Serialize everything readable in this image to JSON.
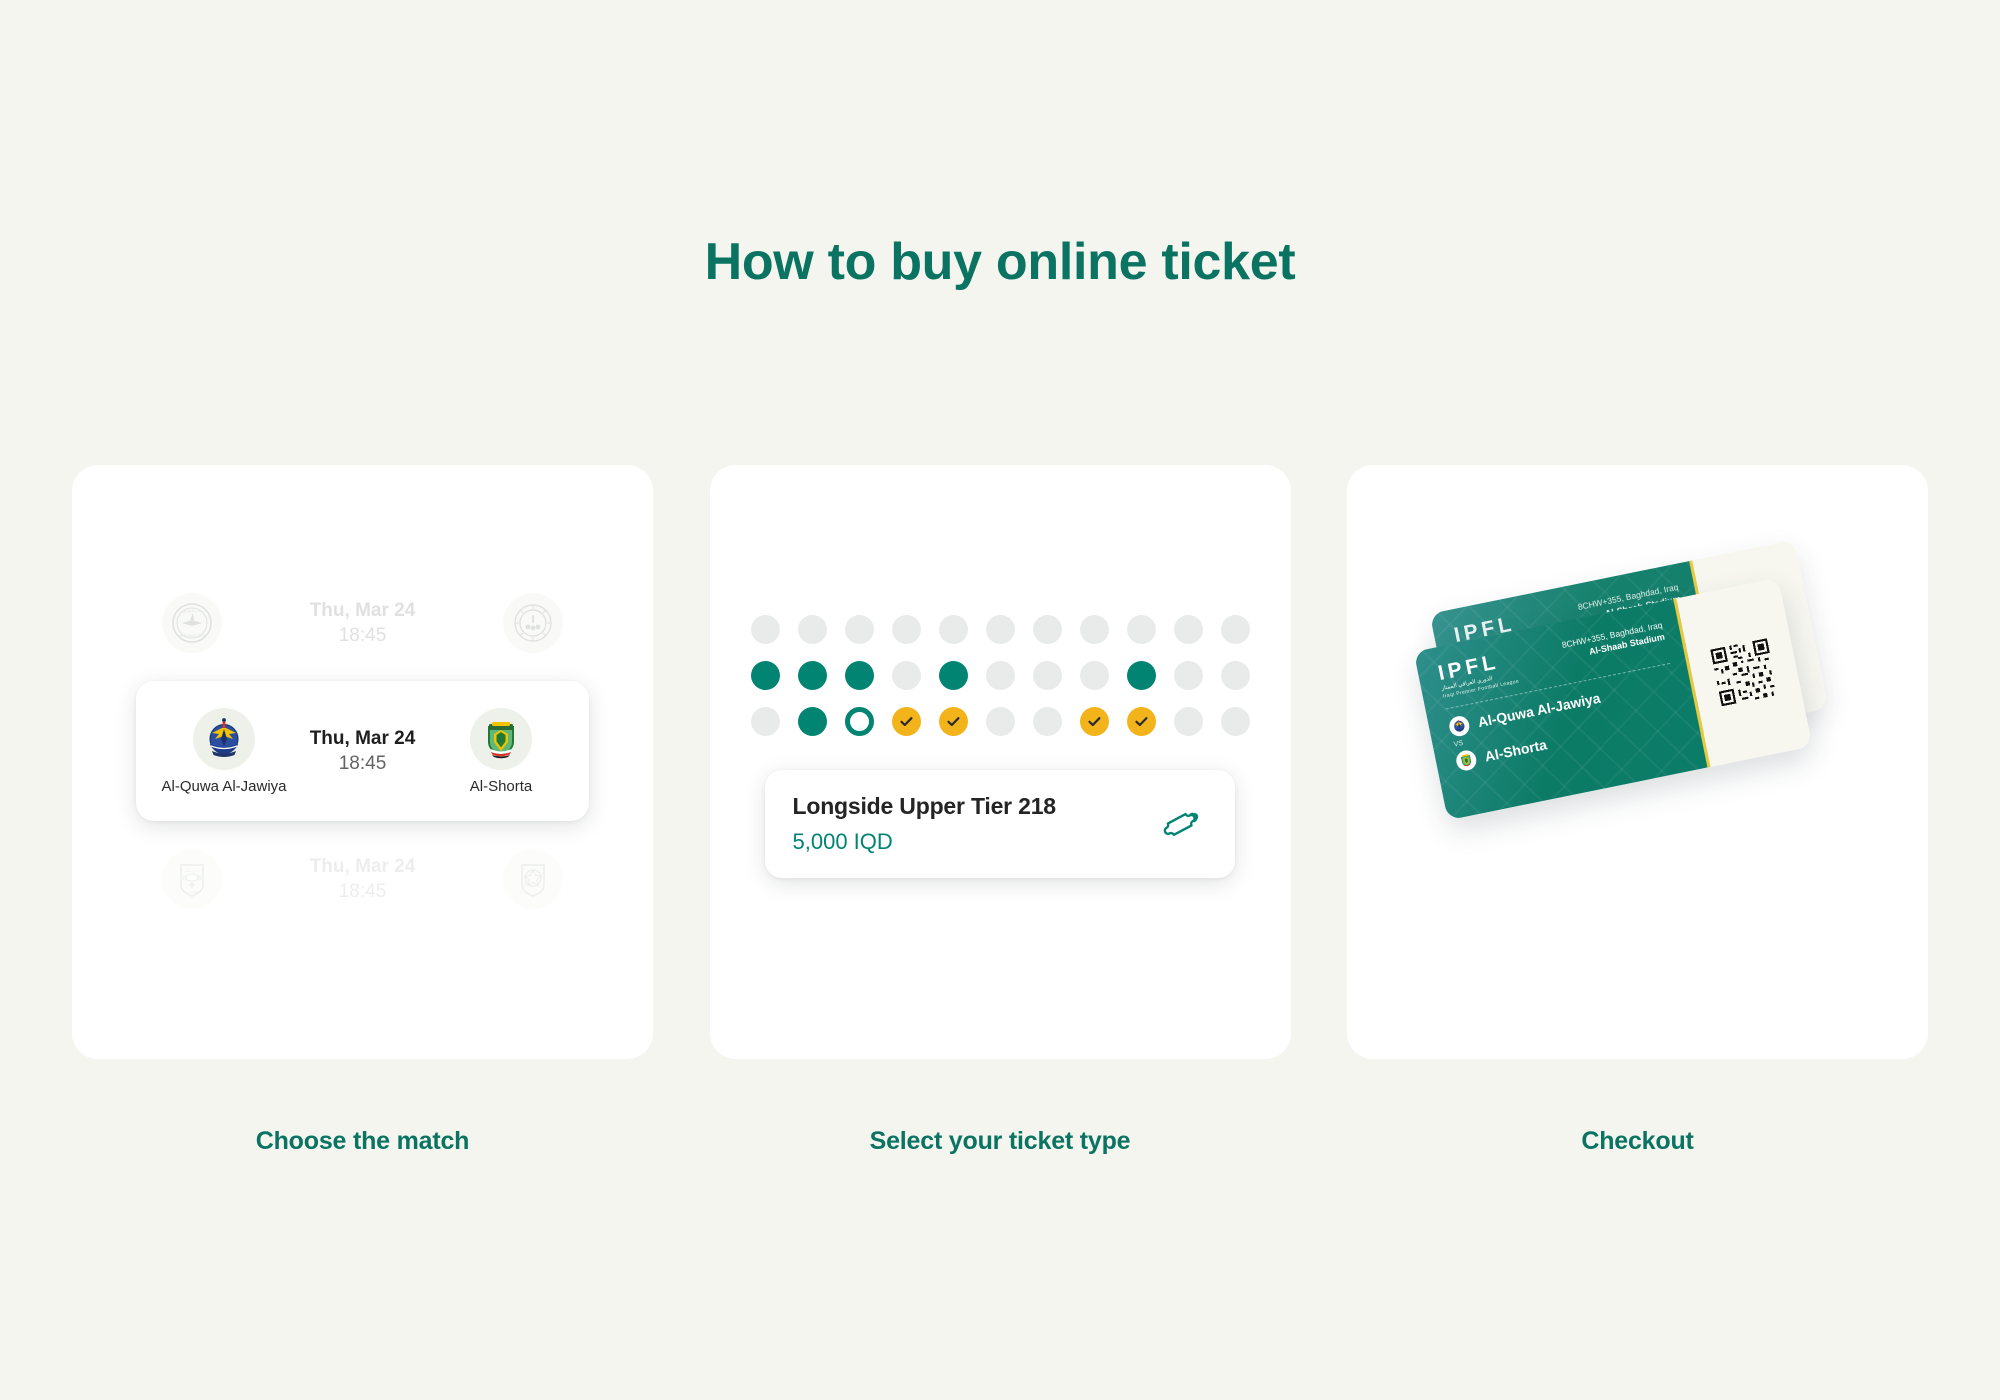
{
  "page": {
    "title": "How to buy online ticket",
    "background_color": "#f5f5f0",
    "accent_color": "#0a7361"
  },
  "steps": [
    {
      "id": "choose-match",
      "caption": "Choose the match",
      "matches": [
        {
          "state": "dimmed",
          "date": "Thu, Mar 24",
          "time": "18:45",
          "home_team": "",
          "away_team": "",
          "home_crest": "al-naft-crest-icon",
          "away_crest": "al-minaa-crest-icon"
        },
        {
          "state": "selected",
          "date": "Thu, Mar 24",
          "time": "18:45",
          "home_team": "Al-Quwa Al-Jawiya",
          "away_team": "Al-Shorta",
          "home_crest": "al-quwa-al-jawiya-crest-icon",
          "away_crest": "al-shorta-crest-icon"
        },
        {
          "state": "dimmed",
          "date": "Thu, Mar 24",
          "time": "18:45",
          "home_team": "",
          "away_team": "",
          "home_crest": "al-talaba-crest-icon",
          "away_crest": "al-zawraa-crest-icon"
        }
      ]
    },
    {
      "id": "select-ticket-type",
      "caption": "Select your ticket type",
      "seat_map": {
        "legend": {
          "available_color": "#e9eaea",
          "taken_color": "#018472",
          "highlight_color": "#018472",
          "selected_color": "#f2b31b"
        },
        "rows": [
          [
            "available",
            "available",
            "available",
            "available",
            "available",
            "available",
            "available",
            "available",
            "available",
            "available",
            "available"
          ],
          [
            "taken",
            "taken",
            "taken",
            "available",
            "taken",
            "available",
            "available",
            "available",
            "taken",
            "available",
            "available"
          ],
          [
            "available",
            "taken",
            "open",
            "selected",
            "selected",
            "available",
            "available",
            "selected",
            "selected",
            "available",
            "available"
          ]
        ]
      },
      "ticket_type": {
        "name": "Longside Upper Tier 218",
        "price": "5,000 IQD",
        "icon": "ticket-icon"
      }
    },
    {
      "id": "checkout",
      "caption": "Checkout",
      "tickets": [
        {
          "brand": "IPFL",
          "brand_arabic": "الدوري العراقي الممتاز",
          "brand_subtitle": "Iraqi Premier Football League",
          "venue_address": "8CHW+355, Baghdad, Iraq",
          "venue_name": "Al-Shaab Stadium",
          "home_team": "Al-Quwa Al-Jawiya",
          "vs_label": "VS",
          "away_team": "Al-Shorta",
          "qr": "qr-code-icon"
        },
        {
          "brand": "IPFL",
          "brand_arabic": "الدوري العراقي الممتاز",
          "brand_subtitle": "Iraqi Premier Football League",
          "venue_address": "8CHW+355, Baghdad, Iraq",
          "venue_name": "Al-Shaab Stadium",
          "home_team": "Al-Quwa Al-Jawiya",
          "vs_label": "VS",
          "away_team": "Al-Shorta",
          "qr": "qr-code-icon"
        }
      ]
    }
  ]
}
